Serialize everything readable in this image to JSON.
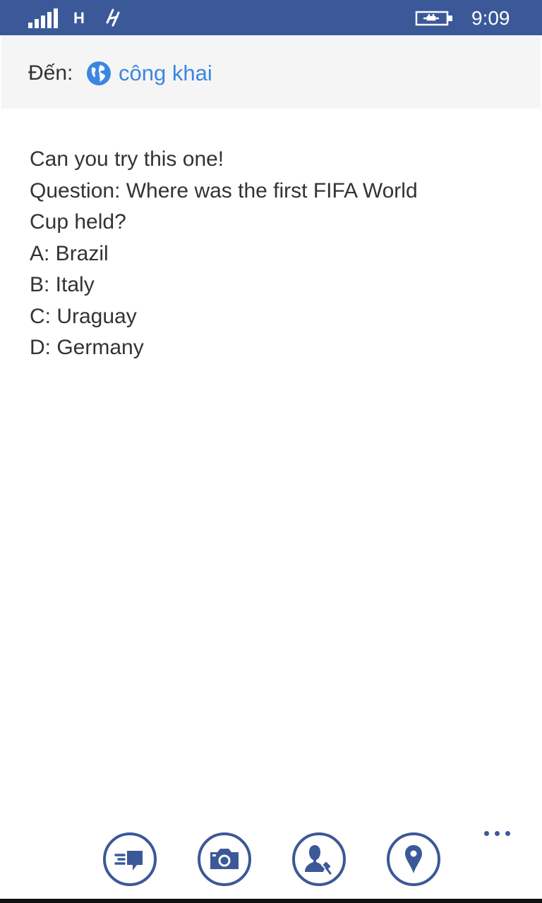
{
  "status_bar": {
    "network_type": "H",
    "time": "9:09",
    "icons": [
      "signal-strength-icon",
      "data-transfer-icon",
      "battery-charging-icon"
    ]
  },
  "compose": {
    "to_label": "Đến:",
    "audience_icon": "globe-icon",
    "audience": "công khai"
  },
  "post": {
    "lines": [
      "Can you try this one!",
      "Question: Where was the first FIFA World",
      "Cup held?",
      "A: Brazil",
      "B: Italy",
      "C: Uraguay",
      "D: Germany"
    ]
  },
  "app_bar": {
    "buttons": [
      "post-status-icon",
      "camera-icon",
      "tag-friend-icon",
      "location-pin-icon"
    ],
    "more": "more-options-icon"
  },
  "colors": {
    "brand": "#3b5998",
    "link": "#3b86e3",
    "text": "#333333",
    "header_bg": "#f5f5f5"
  }
}
